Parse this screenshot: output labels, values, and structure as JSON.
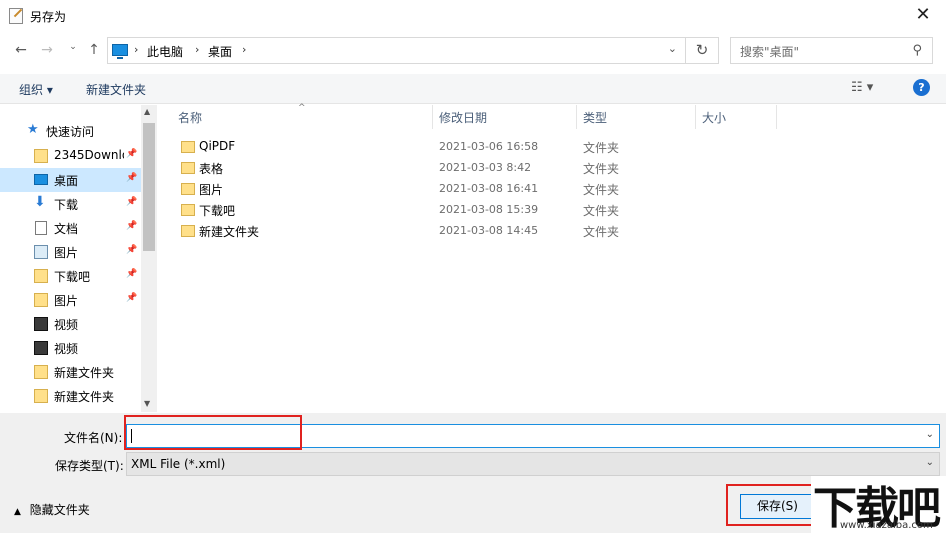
{
  "window": {
    "title": "另存为"
  },
  "nav": {
    "breadcrumbs": [
      "此电脑",
      "桌面"
    ],
    "search_placeholder": "搜索\"桌面\""
  },
  "toolbar": {
    "organize": "组织 ▾",
    "new_folder": "新建文件夹"
  },
  "sidebar": {
    "items": [
      {
        "label": "快速访问",
        "icon": "star-icon",
        "pinned": false
      },
      {
        "label": "2345Downloa",
        "icon": "folder-icon",
        "pinned": true
      },
      {
        "label": "桌面",
        "icon": "desktop-icon",
        "pinned": true,
        "selected": true
      },
      {
        "label": "下载",
        "icon": "download-icon",
        "pinned": true
      },
      {
        "label": "文档",
        "icon": "document-icon",
        "pinned": true
      },
      {
        "label": "图片",
        "icon": "picture-icon",
        "pinned": true
      },
      {
        "label": "下载吧",
        "icon": "folder-icon",
        "pinned": true
      },
      {
        "label": "图片",
        "icon": "folder-icon",
        "pinned": true
      },
      {
        "label": "视频",
        "icon": "video-icon",
        "pinned": false
      },
      {
        "label": "视频",
        "icon": "video-icon",
        "pinned": false
      },
      {
        "label": "新建文件夹",
        "icon": "folder-icon",
        "pinned": false
      },
      {
        "label": "新建文件夹",
        "icon": "folder-icon",
        "pinned": false
      }
    ]
  },
  "filelist": {
    "columns": [
      "名称",
      "修改日期",
      "类型",
      "大小"
    ],
    "rows": [
      {
        "name": "QiPDF",
        "date": "2021-03-06 16:58",
        "type": "文件夹"
      },
      {
        "name": "表格",
        "date": "2021-03-03 8:42",
        "type": "文件夹"
      },
      {
        "name": "图片",
        "date": "2021-03-08 16:41",
        "type": "文件夹"
      },
      {
        "name": "下载吧",
        "date": "2021-03-08 15:39",
        "type": "文件夹"
      },
      {
        "name": "新建文件夹",
        "date": "2021-03-08 14:45",
        "type": "文件夹"
      }
    ]
  },
  "form": {
    "filename_label": "文件名(N):",
    "filename_value": "",
    "filetype_label": "保存类型(T):",
    "filetype_value": "XML File (*.xml)",
    "hide_folders": "隐藏文件夹",
    "save_button": "保存(S)"
  },
  "watermark": {
    "text": "下载吧",
    "url": "www.xiazaiba.com"
  },
  "colors": {
    "accent": "#0078d7",
    "highlight": "#e0221f",
    "selection": "#cce8ff"
  }
}
